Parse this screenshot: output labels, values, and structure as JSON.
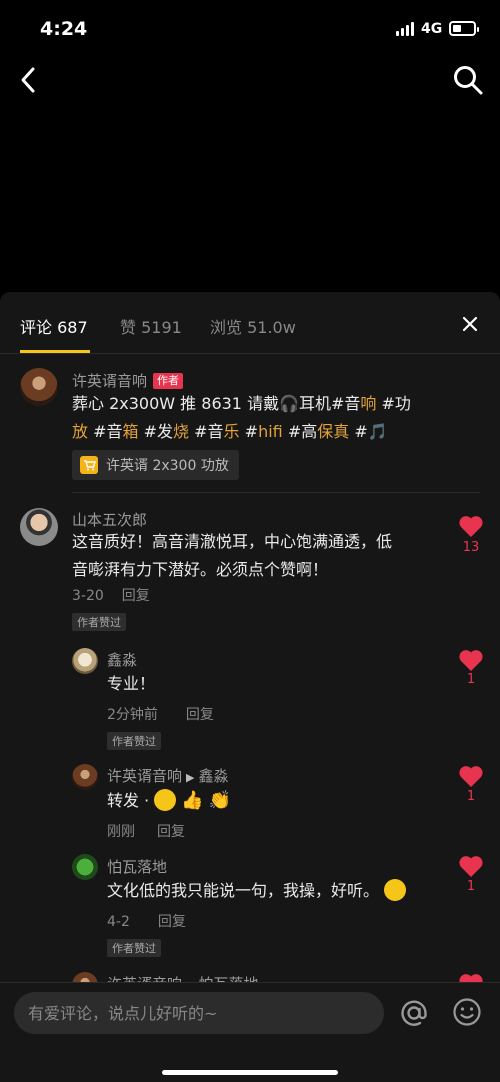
{
  "status_bar": {
    "time": "4:24",
    "network": "4G"
  },
  "tabs": [
    {
      "label": "评论 687"
    },
    {
      "label": "赞 5191"
    },
    {
      "label": "浏览 51.0w"
    }
  ],
  "post": {
    "author": "许英谞音响",
    "author_tag": "作者",
    "text_line1": "葬心 2x300W 推 8631 请戴🎧耳机#音",
    "text_line1_hl": "响",
    "text_line1_end": " #功",
    "text_line2_a": "放",
    "text_line2_b": " #音",
    "text_line2_c": "箱",
    "text_line2_d": " #发",
    "text_line2_e": "烧",
    "text_line2_f": " #音",
    "text_line2_g": "乐",
    "text_line2_h": " #",
    "text_line2_i": "hifi",
    "text_line2_j": " #高",
    "text_line2_k": "保真",
    "text_line2_l": " #🎵",
    "product_label": "许英谞 2x300 功放"
  },
  "comments": [
    {
      "name": "山本五次郎",
      "text_line1": "这音质好！高音清澈悦耳，中心饱满通透，低",
      "text_line2": "音嘭湃有力下潜好。必须点个赞啊！",
      "date": "3-20",
      "reply": "回复",
      "badge": "作者赞过",
      "likes": "13"
    }
  ],
  "replies": [
    {
      "name": "鑫淼",
      "text": "专业！",
      "date": "2分钟前",
      "reply": "回复",
      "badge": "作者赞过",
      "likes": "1"
    },
    {
      "name": "许英谞音响",
      "reply_to": "鑫淼",
      "text": "转发 · ",
      "date": "刚刚",
      "reply": "回复",
      "likes": "1"
    },
    {
      "name": "怕瓦落地",
      "text": "文化低的我只能说一句，我操，好听。",
      "date": "4-2",
      "reply": "回复",
      "badge": "作者赞过",
      "likes": "1"
    },
    {
      "name": "许英谞音响",
      "reply_to": "怕瓦落地"
    }
  ],
  "input": {
    "placeholder": "有爱评论，说点儿好听的~"
  },
  "colors": {
    "accent": "#f5c518",
    "like_red": "#e8344e",
    "hashtag": "#e2a33a",
    "sheet_bg": "#161616"
  },
  "icons": [
    "back-arrow-icon",
    "search-icon",
    "close-icon",
    "heart-icon",
    "cart-icon",
    "at-icon",
    "emoji-icon"
  ]
}
